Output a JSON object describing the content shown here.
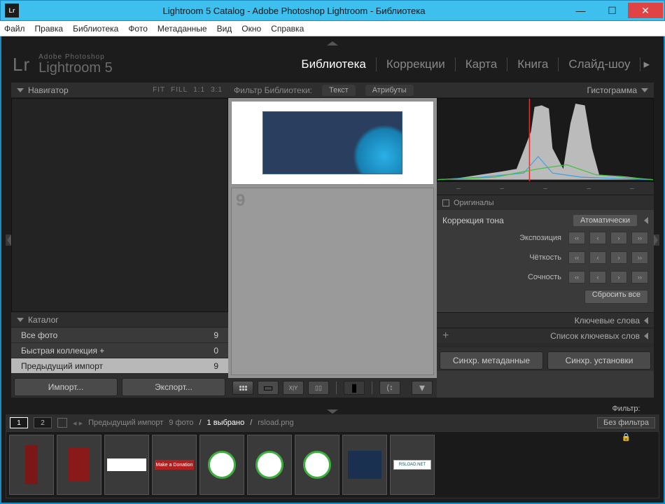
{
  "window": {
    "icon": "Lr",
    "title": "Lightroom 5 Catalog - Adobe Photoshop Lightroom - Библиотека"
  },
  "menu": {
    "items": [
      "Файл",
      "Правка",
      "Библиотека",
      "Фото",
      "Метаданные",
      "Вид",
      "Окно",
      "Справка"
    ]
  },
  "brand": {
    "logo": "Lr",
    "line1": "Adobe Photoshop",
    "line2": "Lightroom 5"
  },
  "modules": {
    "items": [
      "Библиотека",
      "Коррекции",
      "Карта",
      "Книга",
      "Слайд-шоу"
    ],
    "active": 0
  },
  "navigator": {
    "title": "Навигатор",
    "opts": [
      "FIT",
      "FILL",
      "1:1",
      "3:1"
    ]
  },
  "catalog": {
    "title": "Каталог",
    "rows": [
      {
        "label": "Все фото",
        "count": "9"
      },
      {
        "label": "Быстрая коллекция  +",
        "count": "0"
      },
      {
        "label": "Предыдущий импорт",
        "count": "9",
        "selected": true
      }
    ]
  },
  "left_buttons": {
    "import": "Импорт...",
    "export": "Экспорт..."
  },
  "filter": {
    "label": "Фильтр Библиотеки:",
    "tabs": [
      "Текст",
      "Атрибуты"
    ]
  },
  "grid": {
    "last_index": "9"
  },
  "histogram": {
    "title": "Гистограмма",
    "dashes": [
      "–",
      "–",
      "–",
      "–",
      "–"
    ],
    "originals": "Оригиналы"
  },
  "quickdev": {
    "title": "Коррекция тона",
    "auto": "Атоматически",
    "rows": [
      {
        "label": "Экспозиция"
      },
      {
        "label": "Чёткость"
      },
      {
        "label": "Сочность"
      }
    ],
    "reset": "Сбросить все"
  },
  "keywords": {
    "title": "Ключевые слова"
  },
  "keyword_list": {
    "title": "Список ключевых слов"
  },
  "sync": {
    "meta": "Синхр. метаданные",
    "settings": "Синхр. установки"
  },
  "filmstrip": {
    "seg": [
      "1",
      "2"
    ],
    "path_prefix": "Предыдущий импорт",
    "count": "9 фото",
    "selected": "1 выбрано",
    "filename": "rsload.png",
    "filter_label": "Фильтр:",
    "filter_value": "Без фильтра",
    "thumbs": [
      "red",
      "red2",
      "white",
      "donate",
      "ut",
      "ut",
      "ut",
      "blue",
      "load"
    ],
    "donate_text": "Make a Donation",
    "load_text": "RSLOAD.NET"
  }
}
